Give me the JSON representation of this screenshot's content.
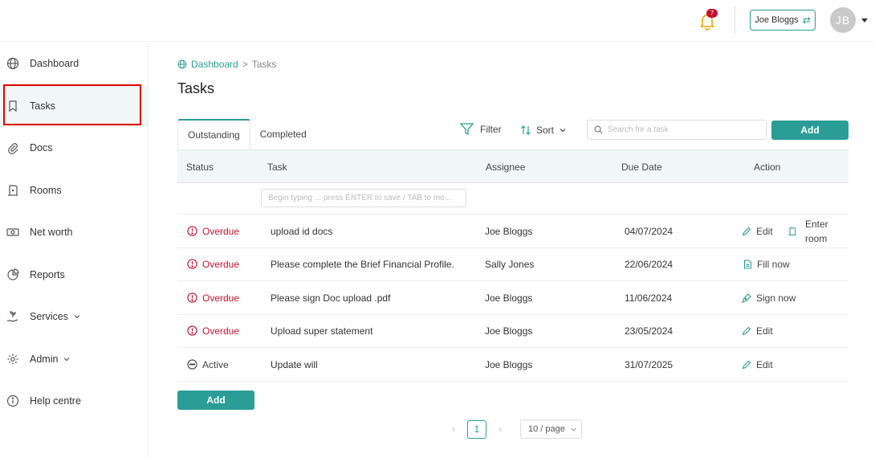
{
  "header": {
    "notification_count": "7",
    "user_switch_label": "Joe Bloggs",
    "avatar_initials": "JB"
  },
  "sidebar": {
    "items": [
      {
        "label": "Dashboard",
        "icon": "globe-icon"
      },
      {
        "label": "Tasks",
        "icon": "bookmark-icon",
        "active": true
      },
      {
        "label": "Docs",
        "icon": "paperclip-icon"
      },
      {
        "label": "Rooms",
        "icon": "door-icon"
      },
      {
        "label": "Net worth",
        "icon": "cash-icon"
      },
      {
        "label": "Reports",
        "icon": "pie-chart-icon"
      },
      {
        "label": "Services",
        "icon": "hand-plant-icon",
        "has_dropdown": true
      },
      {
        "label": "Admin",
        "icon": "gear-icon",
        "has_dropdown": true
      },
      {
        "label": "Help centre",
        "icon": "info-icon"
      }
    ]
  },
  "breadcrumb": {
    "home": "Dashboard",
    "separator": ">",
    "current": "Tasks"
  },
  "page_title": "Tasks",
  "tabs": [
    {
      "label": "Outstanding",
      "active": true
    },
    {
      "label": "Completed",
      "active": false
    }
  ],
  "toolbar": {
    "filter_label": "Filter",
    "sort_label": "Sort",
    "search_placeholder": "Search for a task",
    "add_label": "Add"
  },
  "table": {
    "columns": [
      "Status",
      "Task",
      "Assignee",
      "Due Date",
      "Action"
    ],
    "new_task_placeholder": "Begin typing ... press ENTER to save / TAB to mo...",
    "rows": [
      {
        "status": "Overdue",
        "task": "upload id docs",
        "assignee": "Joe Bloggs",
        "due": "04/07/2024",
        "action": "Edit",
        "action2_line1": "Enter",
        "action2_line2": "room"
      },
      {
        "status": "Overdue",
        "task": "Please complete the Brief Financial Profile.",
        "assignee": "Sally Jones",
        "due": "22/06/2024",
        "action": "Fill now"
      },
      {
        "status": "Overdue",
        "task": "Please sign Doc upload .pdf",
        "assignee": "Joe Bloggs",
        "due": "11/06/2024",
        "action": "Sign now"
      },
      {
        "status": "Overdue",
        "task": "Upload super statement",
        "assignee": "Joe Bloggs",
        "due": "23/05/2024",
        "action": "Edit"
      },
      {
        "status": "Active",
        "task": "Update will",
        "assignee": "Joe Bloggs",
        "due": "31/07/2025",
        "action": "Edit"
      }
    ]
  },
  "footer": {
    "add_label": "Add",
    "current_page": "1",
    "page_size": "10 / page"
  },
  "colors": {
    "accent": "#2a9d96",
    "overdue": "#c8102e",
    "highlight": "#e00000"
  }
}
